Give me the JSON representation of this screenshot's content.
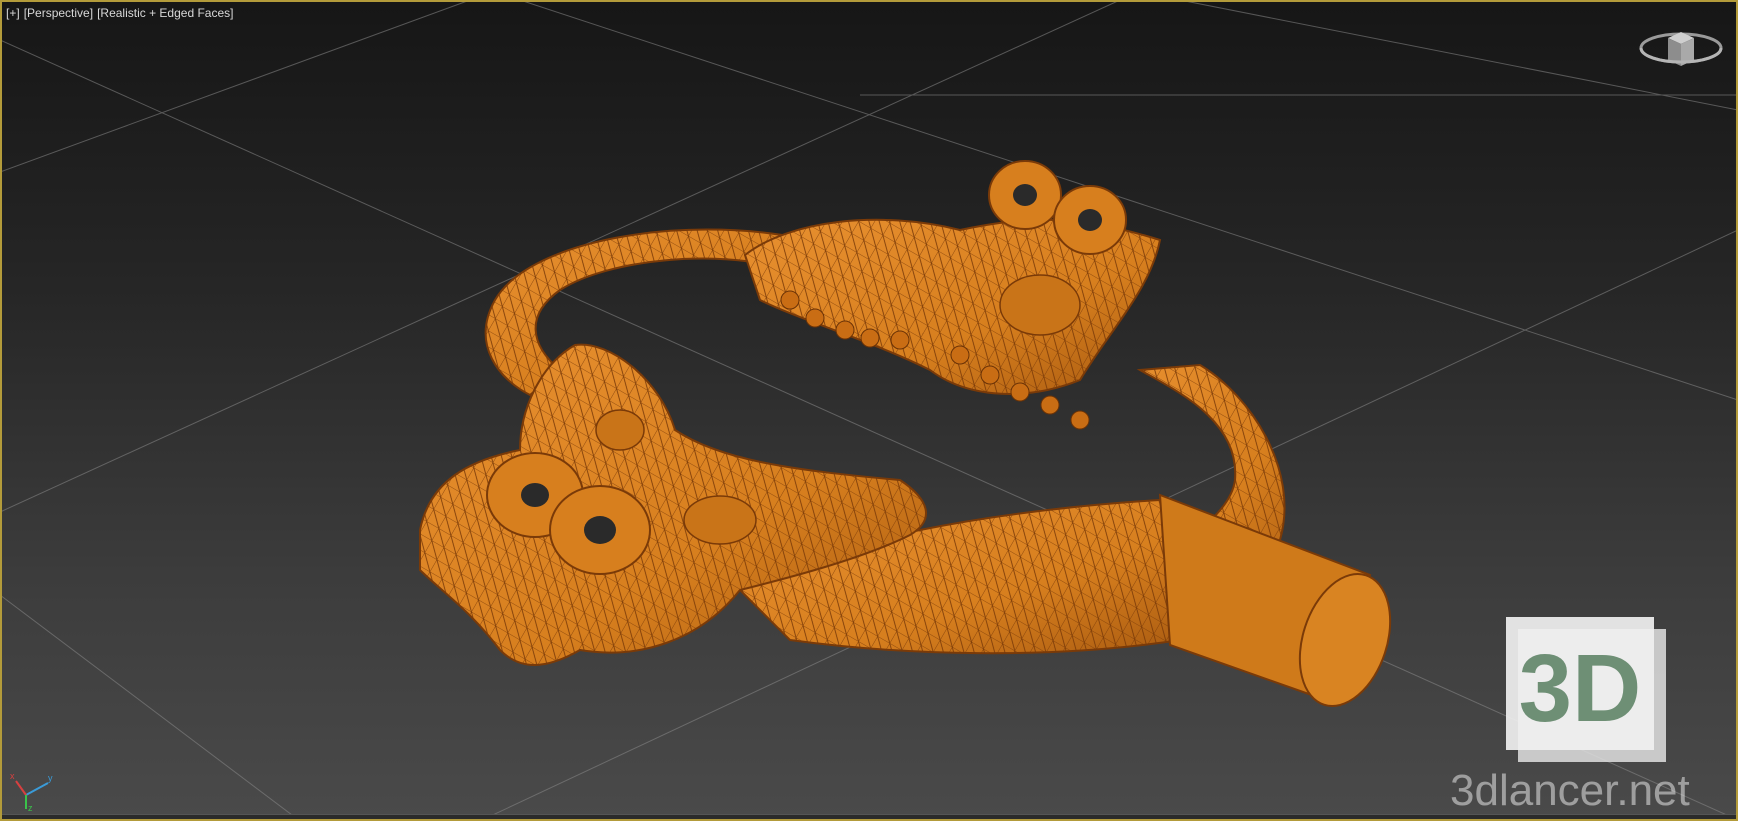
{
  "viewport": {
    "labels": [
      "[+]",
      "[Perspective]",
      "[Realistic + Edged Faces]"
    ]
  },
  "colors": {
    "model": "#d77f1e",
    "model_shade": "#a85a10",
    "wire": "#7a3a08",
    "grid": "#8a8a8a",
    "border": "#b39b3a"
  },
  "icons": {
    "viewcube": "viewcube-icon",
    "axis": "axis-tripod-icon"
  },
  "watermark": {
    "logo_text": "3D",
    "site": "3dlancer.net"
  },
  "axis": {
    "x": "x",
    "y": "y",
    "z": "z"
  }
}
